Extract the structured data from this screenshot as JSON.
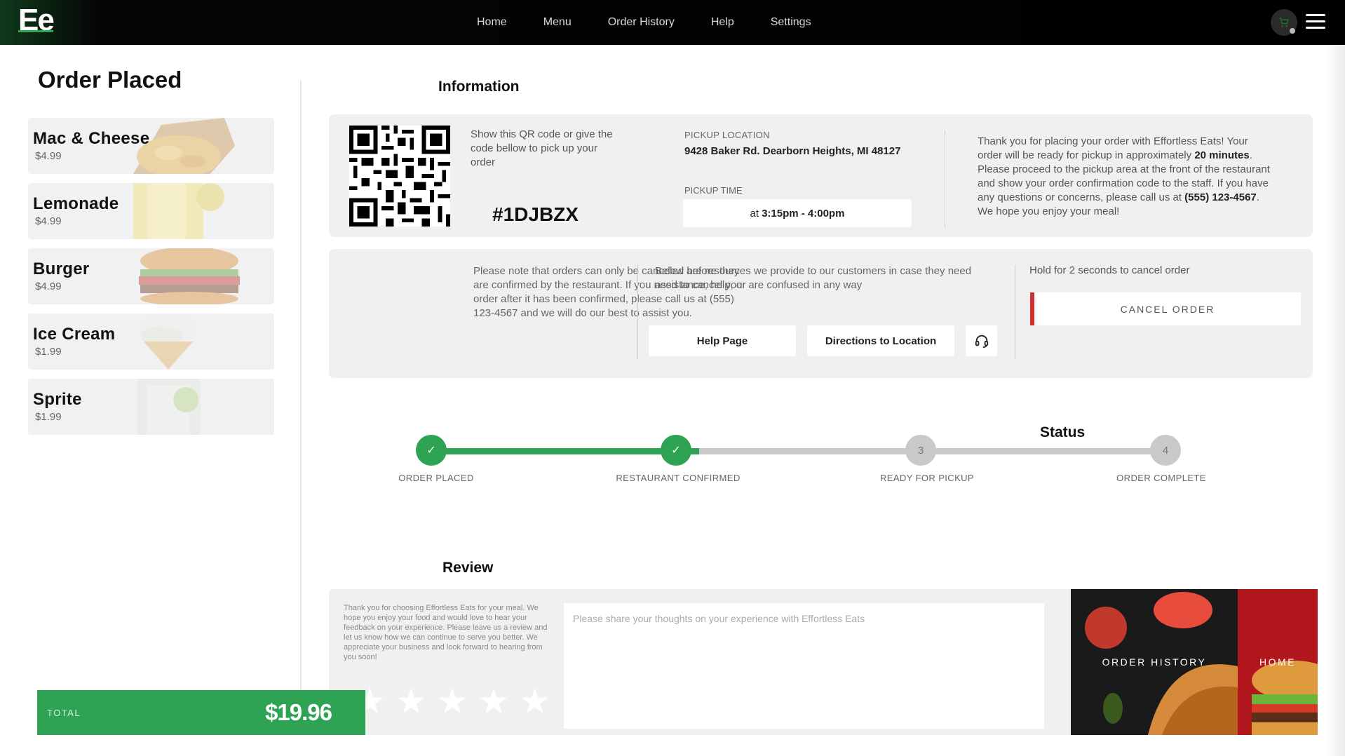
{
  "nav": {
    "logo": "Ee",
    "links": [
      "Home",
      "Menu",
      "Order History",
      "Help",
      "Settings"
    ]
  },
  "order": {
    "title": "Order Placed",
    "items": [
      {
        "name": "Mac & Cheese",
        "price": "$4.99",
        "image": "mac-cheese-image"
      },
      {
        "name": "Lemonade",
        "price": "$4.99",
        "image": "lemonade-image"
      },
      {
        "name": "Burger",
        "price": "$4.99",
        "image": "burger-image"
      },
      {
        "name": "Ice Cream",
        "price": "$1.99",
        "image": "ice-cream-image"
      },
      {
        "name": "Sprite",
        "price": "$1.99",
        "image": "sprite-image"
      }
    ],
    "total_label": "TOTAL",
    "total_value": "$19.96"
  },
  "info": {
    "title": "Information",
    "qr_instructions": "Show this QR code or give the code bellow to pick up your order",
    "code": "#1DJBZX",
    "pickup_location_label": "PICKUP LOCATION",
    "pickup_location": "9428 Baker Rd. Dearborn Heights, MI 48127",
    "pickup_time_label": "PICKUP TIME",
    "pickup_time_prefix": "at",
    "pickup_time": "3:15pm - 4:00pm",
    "thanks_1": "Thank you for placing your order with Effortless Eats! Your order will be ready for pickup in approximately ",
    "thanks_minutes": "20 minutes",
    "thanks_2": ". Please proceed to the pickup area at the front of the restaurant and show your order confirmation code to the staff. If you have any questions or concerns, please call us at ",
    "thanks_phone": "(555) 123-4567",
    "thanks_3": ". We hope you enjoy your meal!"
  },
  "contact": {
    "note": "Please note that orders can only be canceled before they are confirmed by the restaurant. If you need to cancel your order after it has been confirmed, please call us at (555) 123-4567 and we will do our best to assist you.",
    "assist": "Below are resources we provide to our customers in case they need assistance, help, or are confused in any way",
    "help_button": "Help Page",
    "directions_button": "Directions to Location",
    "support_icon": "headset-icon",
    "hold_text": "Hold for 2 seconds to cancel order",
    "cancel_button": "CANCEL ORDER"
  },
  "status": {
    "title": "Status",
    "progress_fraction": 0.365,
    "steps": [
      {
        "label": "ORDER PLACED",
        "marker": "✓",
        "done": true
      },
      {
        "label": "RESTAURANT CONFIRMED",
        "marker": "✓",
        "done": true
      },
      {
        "label": "READY FOR PICKUP",
        "marker": "3",
        "done": false
      },
      {
        "label": "ORDER COMPLETE",
        "marker": "4",
        "done": false
      }
    ]
  },
  "review": {
    "title": "Review",
    "text": "Thank you for choosing Effortless Eats for your meal. We hope you enjoy your food and would love to hear your feedback on your experience. Please leave us a review and let us know how we can continue to serve you better. We appreciate your business and look forward to hearing from you soon!",
    "rating": 0,
    "star_count": 5,
    "placeholder": "Please share your thoughts on your experience with Effortless Eats",
    "order_history_button": "ORDER HISTORY",
    "home_button": "HOME"
  },
  "colors": {
    "accent_green": "#2ea354",
    "cancel_red": "#d32f2f",
    "nav_bg": "#000000",
    "panel_bg": "#f0f0f0"
  }
}
